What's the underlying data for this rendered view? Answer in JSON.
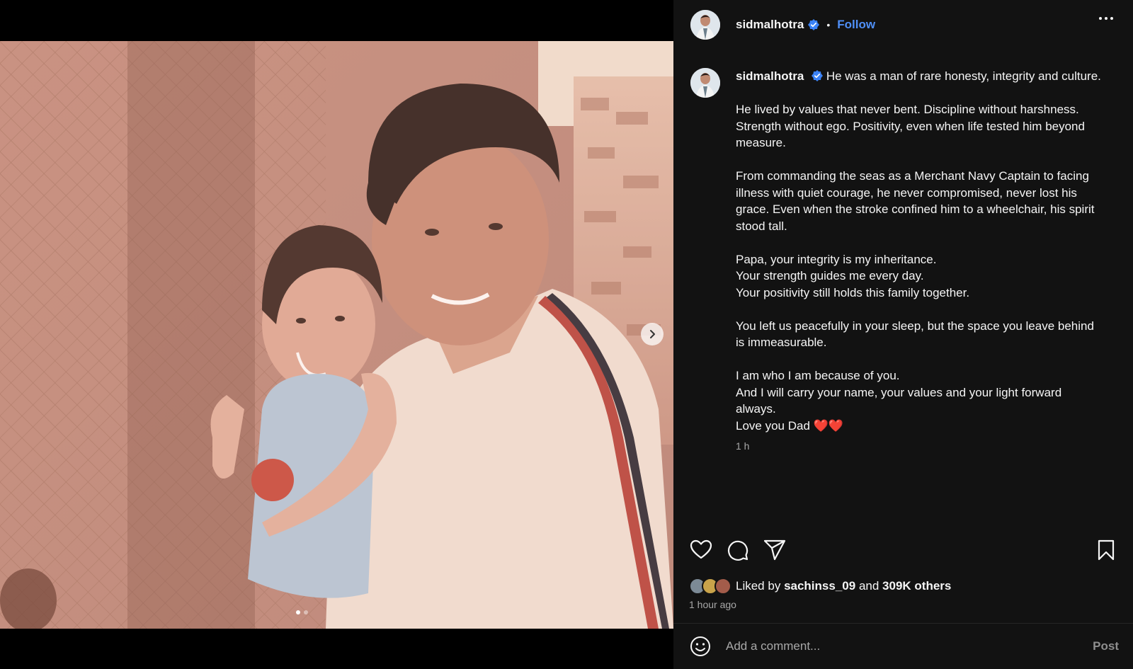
{
  "post": {
    "username": "sidmalhotra",
    "follow_label": "Follow",
    "separator": "•",
    "verified": true
  },
  "caption": {
    "first_line": "He was a man of rare honesty, integrity and culture.",
    "paragraphs": [
      "He lived by values that never bent. Discipline without harshness. Strength without ego. Positivity, even when life tested him beyond measure.",
      "From commanding the seas as a Merchant Navy Captain to facing illness with quiet courage, he never compromised, never lost his grace. Even when the stroke confined him to a wheelchair, his spirit stood tall.",
      "Papa, your integrity is my inheritance.",
      "Your strength guides me every day.",
      "Your positivity still holds this family together.",
      "You left us peacefully in your sleep, but the space you leave behind is immeasurable.",
      "I am who I am because of you.",
      "And I will carry your name, your values and your light forward always.",
      "Love you Dad ❤️❤️"
    ],
    "time": "1 h"
  },
  "likes": {
    "prefix": "Liked by",
    "first_user": "sachinss_09",
    "conjunction": "and",
    "others": "309K others"
  },
  "posted_ago": "1 hour ago",
  "comment": {
    "placeholder": "Add a comment...",
    "post_label": "Post"
  },
  "carousel": {
    "slide_count": 2,
    "active_index": 0
  },
  "colors": {
    "accent": "#4f8ff7",
    "background": "#121212",
    "muted": "#a8a8a8"
  }
}
